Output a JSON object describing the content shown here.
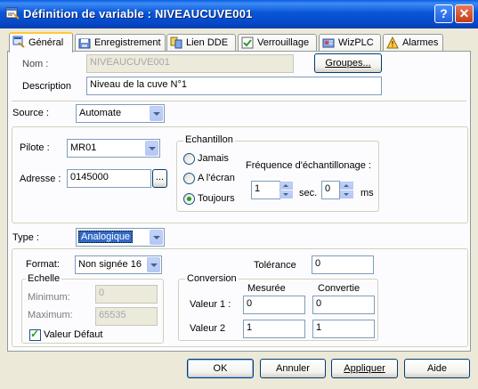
{
  "title": "Définition de variable : NIVEAUCUVE001",
  "titlebar": {
    "help": "?",
    "close": "✕"
  },
  "tabs": [
    {
      "label": "Général",
      "icon": "general-icon"
    },
    {
      "label": "Enregistrement",
      "icon": "record-icon"
    },
    {
      "label": "Lien DDE",
      "icon": "dde-link-icon"
    },
    {
      "label": "Verrouillage",
      "icon": "lock-icon"
    },
    {
      "label": "WizPLC",
      "icon": "wizplc-icon"
    },
    {
      "label": "Alarmes",
      "icon": "alarm-icon"
    }
  ],
  "general": {
    "nom_label": "Nom :",
    "nom_value": "NIVEAUCUVE001",
    "groupes_button": "Groupes...",
    "description_label": "Description",
    "description_value": "Niveau de la cuve N°1",
    "source_label": "Source :",
    "source_value": "Automate",
    "pilote_label": "Pilote :",
    "pilote_value": "MR01",
    "adresse_label": "Adresse :",
    "adresse_value": "0145000",
    "browse_button": "...",
    "echantillon": {
      "title": "Echantillon",
      "options": [
        "Jamais",
        "A l'écran",
        "Toujours"
      ],
      "selected": "Toujours",
      "freq_label": "Fréquence d'échantillonage :",
      "sec_value": "1",
      "sec_unit": "sec.",
      "ms_value": "0",
      "ms_unit": "ms"
    },
    "type_label": "Type :",
    "type_value": "Analogique",
    "format_label": "Format:",
    "format_value": "Non signée 16",
    "tolerance_label": "Tolérance",
    "tolerance_value": "0",
    "echelle": {
      "title": "Echelle",
      "minimum_label": "Minimum:",
      "minimum_value": "0",
      "maximum_label": "Maximum:",
      "maximum_value": "65535",
      "default_label": "Valeur Défaut",
      "default_checked": true
    },
    "conversion": {
      "title": "Conversion",
      "col_mesuree": "Mesurée",
      "col_convertie": "Convertie",
      "rows": [
        {
          "label": "Valeur 1 :",
          "mesuree": "0",
          "convertie": "0"
        },
        {
          "label": "Valeur 2",
          "mesuree": "1",
          "convertie": "1"
        }
      ]
    }
  },
  "footer": {
    "ok": "OK",
    "annuler": "Annuler",
    "appliquer": "Appliquer",
    "aide": "Aide"
  },
  "colors": {
    "titlebar": "#0856d8",
    "dialog": "#ece9d8",
    "panel": "#fcfcfe",
    "selection": "#316ac5"
  }
}
